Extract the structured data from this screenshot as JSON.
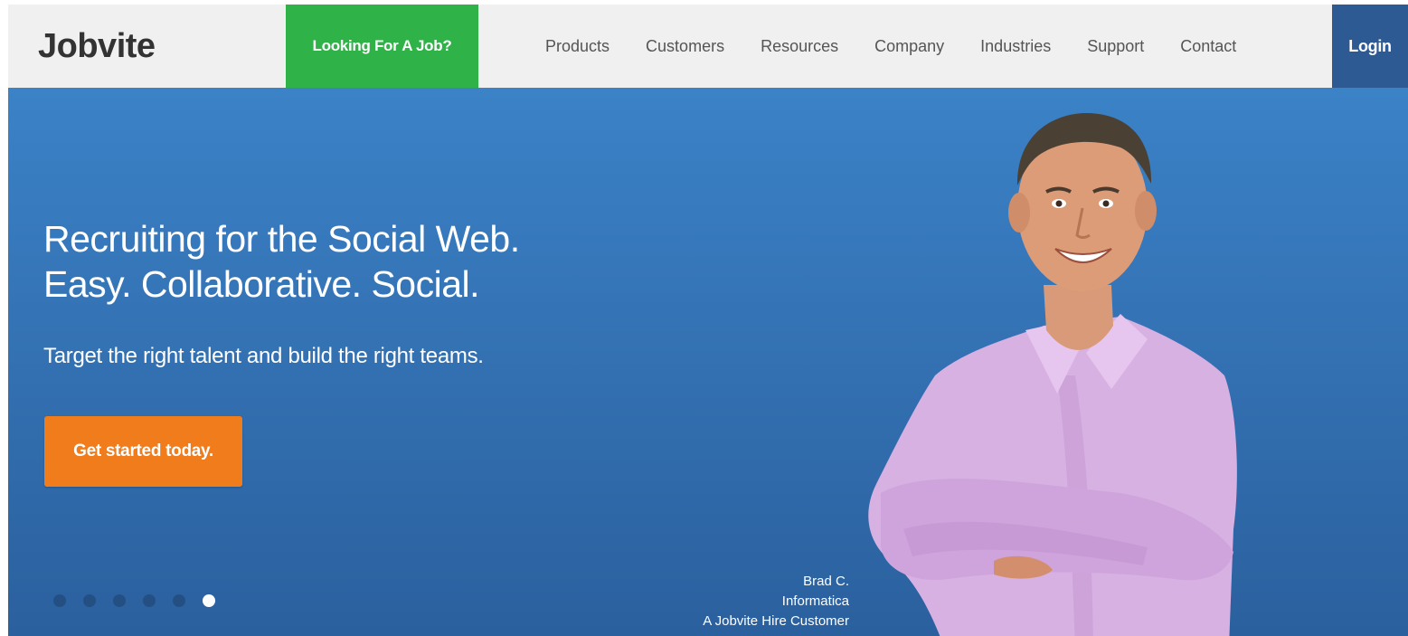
{
  "header": {
    "logo": "Jobvite",
    "job_cta": "Looking For A Job?",
    "nav": [
      "Products",
      "Customers",
      "Resources",
      "Company",
      "Industries",
      "Support",
      "Contact"
    ],
    "login": "Login"
  },
  "hero": {
    "headline_line1": "Recruiting for the Social Web.",
    "headline_line2": "Easy. Collaborative. Social.",
    "subhead": "Target the right talent and build the right teams.",
    "cta": "Get started today.",
    "caption": {
      "name": "Brad C.",
      "company": "Informatica",
      "tagline": "A Jobvite Hire Customer"
    },
    "carousel": {
      "slides": 6,
      "active_index": 5
    }
  },
  "colors": {
    "header_bg": "#f0f0f0",
    "job_cta_bg": "#2fb247",
    "login_bg": "#2d5a93",
    "hero_blue": "#3578bd",
    "cta_orange": "#f07c1b",
    "shirt": "#d9b3e3"
  }
}
